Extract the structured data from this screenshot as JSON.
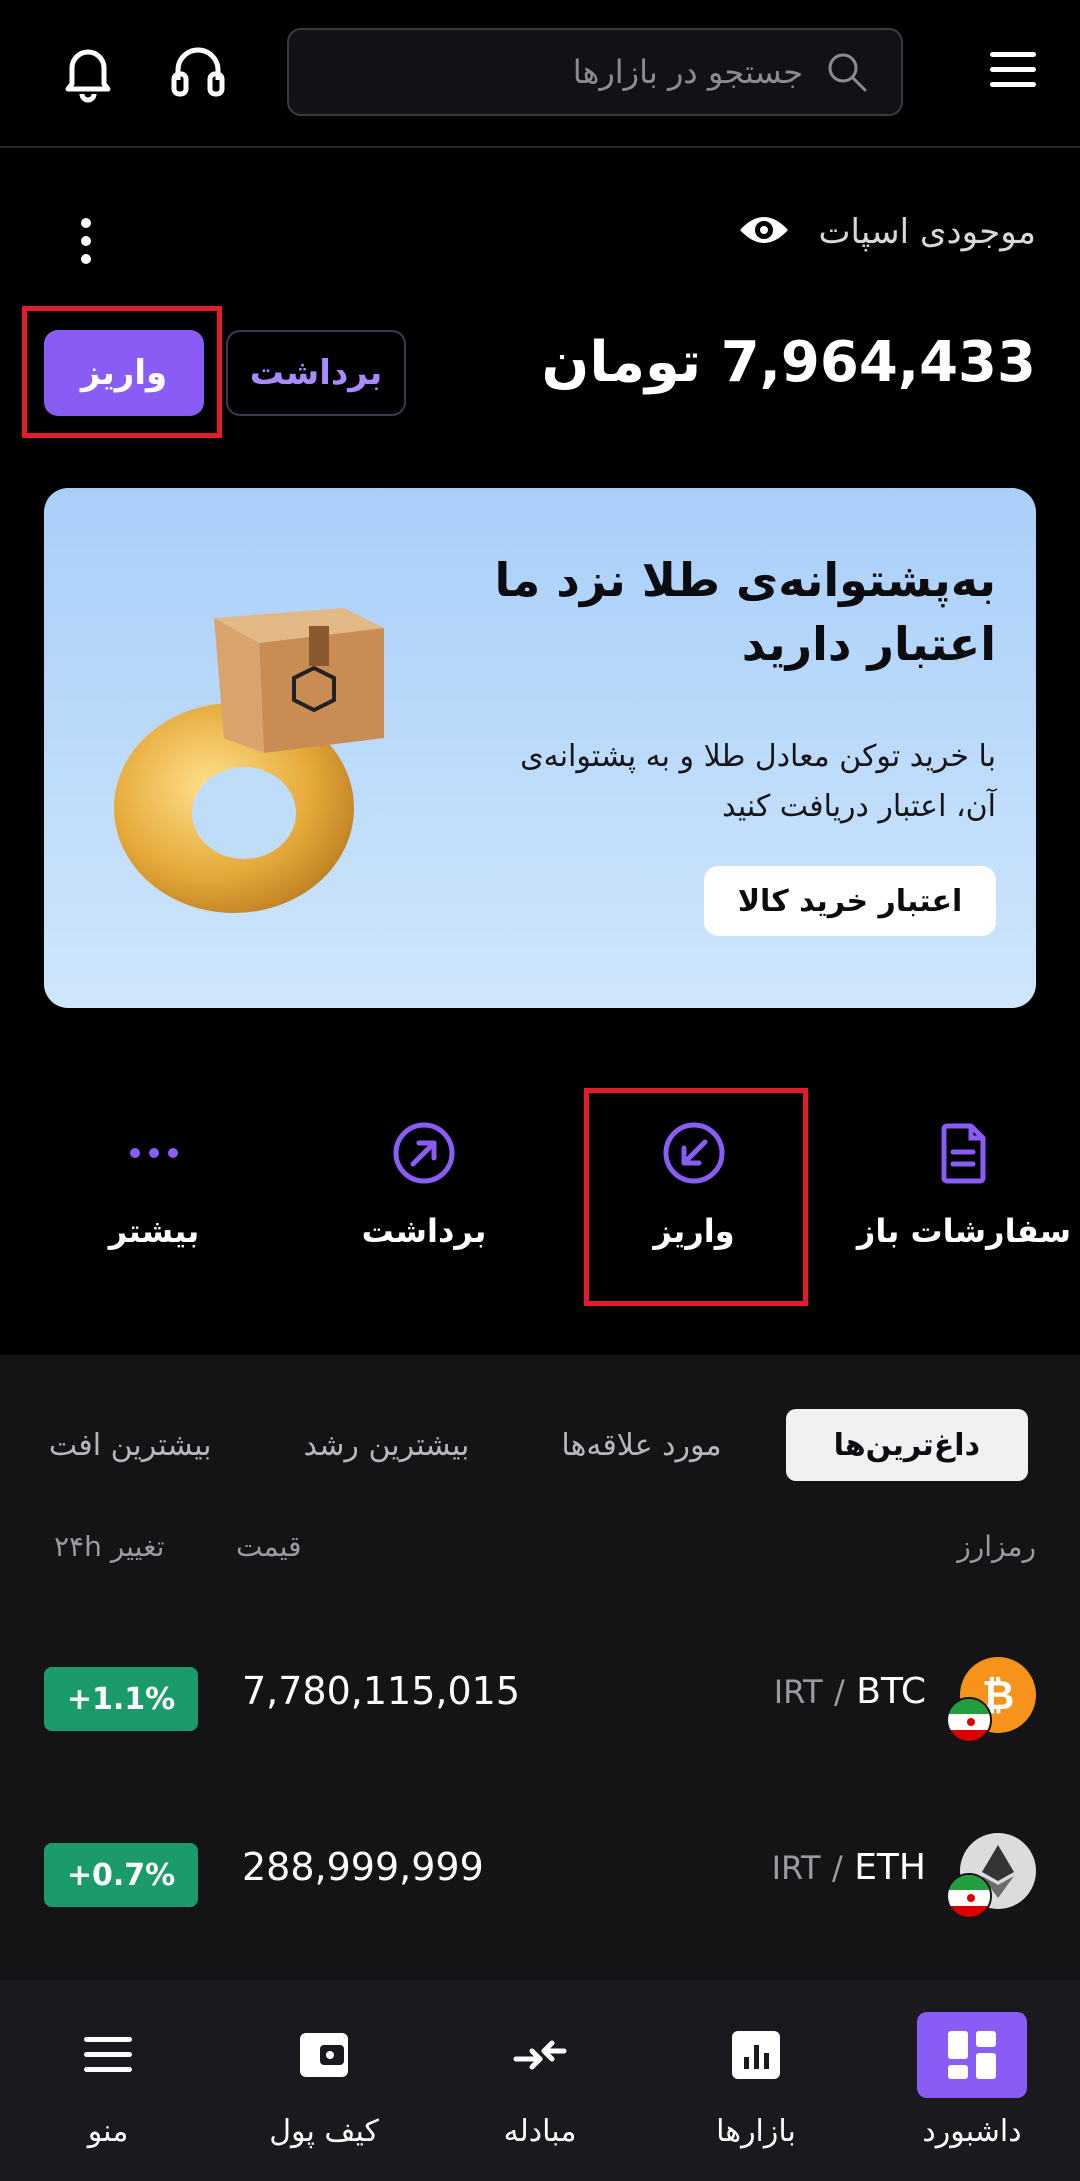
{
  "header": {
    "search_placeholder": "جستجو در بازارها"
  },
  "balance": {
    "label": "موجودی اسپات",
    "amount": "7,964,433 تومان"
  },
  "buttons": {
    "deposit": "واریز",
    "withdraw": "برداشت"
  },
  "banner": {
    "title_line1": "به‌پشتوانه‌ی طلا نزد ما",
    "title_line2": "اعتبار دارید",
    "desc_line1": "با خرید توکن معادل طلا و به پشتوانه‌ی",
    "desc_line2": "آن، اعتبار دریافت کنید",
    "button": "اعتبار خرید کالا"
  },
  "quick_actions": [
    {
      "label": "سفارشات باز",
      "icon": "document-icon"
    },
    {
      "label": "واریز",
      "icon": "deposit-arrow-icon"
    },
    {
      "label": "برداشت",
      "icon": "withdraw-arrow-icon"
    },
    {
      "label": "بیشتر",
      "icon": "more-dots-icon"
    }
  ],
  "market": {
    "tabs": [
      "داغ‌ترین‌ها",
      "مورد علاقه‌ها",
      "بیشترین رشد",
      "بیشترین افت"
    ],
    "columns": {
      "asset": "رمزارز",
      "price": "قیمت",
      "change": "تغییر ۲۴h"
    },
    "rows": [
      {
        "symbol": "BTC",
        "quote": "IRT",
        "separator": "/",
        "price": "7,780,115,015",
        "change": "+1.1%"
      },
      {
        "symbol": "ETH",
        "quote": "IRT",
        "separator": "/",
        "price": "288,999,999",
        "change": "+0.7%"
      }
    ]
  },
  "bottom_nav": [
    {
      "label": "داشبورد",
      "icon": "dashboard-icon",
      "active": true
    },
    {
      "label": "بازارها",
      "icon": "markets-chart-icon"
    },
    {
      "label": "مبادله",
      "icon": "exchange-arrows-icon"
    },
    {
      "label": "کیف پول",
      "icon": "wallet-icon"
    },
    {
      "label": "منو",
      "icon": "menu-icon"
    }
  ],
  "colors": {
    "accent": "#8a5cf6",
    "positive": "#1b9a6c",
    "highlight": "#e11d2a",
    "banner_bg": "#bcdcfa"
  }
}
